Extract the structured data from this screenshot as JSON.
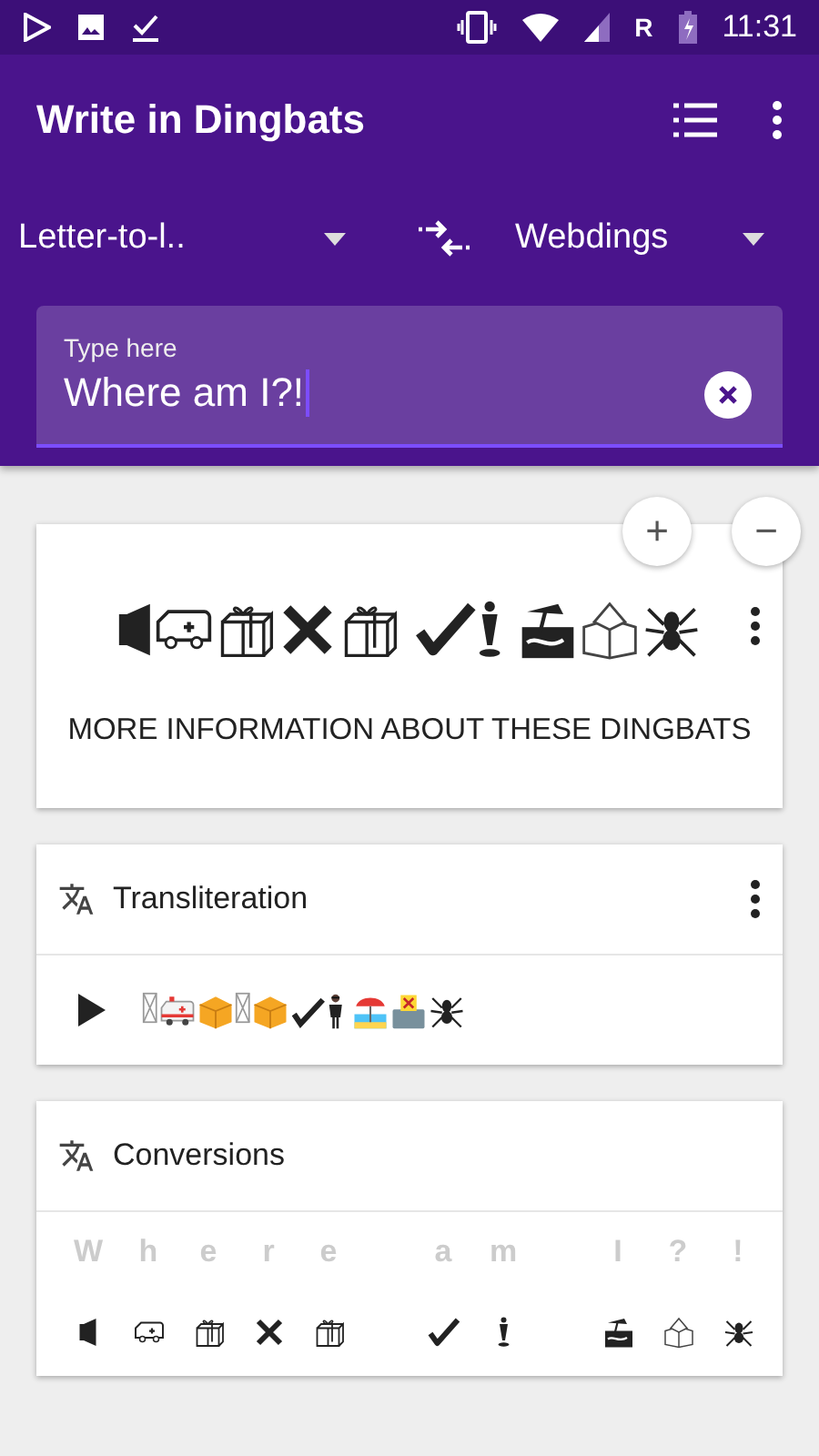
{
  "status_bar": {
    "time": "11:31",
    "network_letter": "R"
  },
  "app_bar": {
    "title": "Write in Dingbats"
  },
  "mode_spinner": {
    "value": "Letter-to-l.."
  },
  "font_spinner": {
    "value": "Webdings"
  },
  "input": {
    "label": "Type here",
    "value": "Where am I?!"
  },
  "preview_card": {
    "glyphs": [
      {
        "kind": "speaker"
      },
      {
        "kind": "van"
      },
      {
        "kind": "gift"
      },
      {
        "kind": "xmark"
      },
      {
        "kind": "gift"
      },
      {
        "kind": "gap"
      },
      {
        "kind": "check"
      },
      {
        "kind": "figure"
      },
      {
        "kind": "gap"
      },
      {
        "kind": "beach"
      },
      {
        "kind": "ballot"
      },
      {
        "kind": "spider"
      }
    ],
    "zoom_in": "+",
    "zoom_out": "−",
    "link": "MORE INFORMATION ABOUT THESE DINGBATS"
  },
  "transliteration_card": {
    "title": "Transliteration",
    "glyphs": [
      {
        "kind": "missing"
      },
      {
        "kind": "ambulance"
      },
      {
        "kind": "package"
      },
      {
        "kind": "missing"
      },
      {
        "kind": "package"
      },
      {
        "kind": "check"
      },
      {
        "kind": "man"
      },
      {
        "kind": "gap"
      },
      {
        "kind": "beach"
      },
      {
        "kind": "ballot"
      },
      {
        "kind": "spider"
      }
    ]
  },
  "conversions_card": {
    "title": "Conversions",
    "columns": [
      {
        "kind": "pair",
        "letter": "W",
        "glyph": {
          "kind": "speaker"
        }
      },
      {
        "kind": "pair",
        "letter": "h",
        "glyph": {
          "kind": "van"
        }
      },
      {
        "kind": "pair",
        "letter": "e",
        "glyph": {
          "kind": "gift"
        }
      },
      {
        "kind": "pair",
        "letter": "r",
        "glyph": {
          "kind": "xmark"
        }
      },
      {
        "kind": "pair",
        "letter": "e",
        "glyph": {
          "kind": "gift"
        }
      },
      {
        "kind": "gap"
      },
      {
        "kind": "pair",
        "letter": "a",
        "glyph": {
          "kind": "check"
        }
      },
      {
        "kind": "pair",
        "letter": "m",
        "glyph": {
          "kind": "figure"
        }
      },
      {
        "kind": "gap"
      },
      {
        "kind": "pair",
        "letter": "I",
        "glyph": {
          "kind": "beach"
        }
      },
      {
        "kind": "pair",
        "letter": "?",
        "glyph": {
          "kind": "ballot"
        }
      },
      {
        "kind": "pair",
        "letter": "!",
        "glyph": {
          "kind": "spider"
        }
      }
    ]
  }
}
